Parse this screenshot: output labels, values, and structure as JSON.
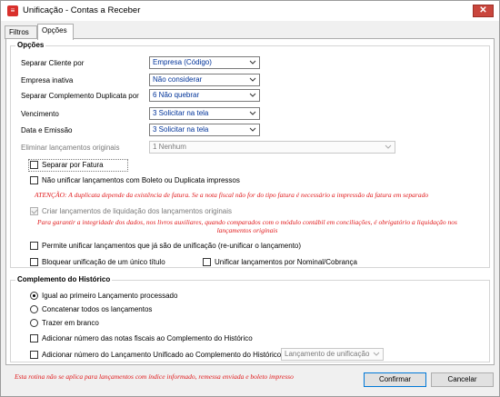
{
  "window": {
    "title": "Unificação - Contas a Receber",
    "close_label": "✕",
    "app_icon": "report-icon"
  },
  "tabs": [
    {
      "label": "Filtros",
      "active": false
    },
    {
      "label": "Opções",
      "active": true
    }
  ],
  "opcoes": {
    "legend": "Opções",
    "fields": [
      {
        "label": "Separar Cliente por",
        "value": "Empresa (Código)"
      },
      {
        "label": "Empresa inativa",
        "value": "Não considerar"
      },
      {
        "label": "Separar Complemento Duplicata por",
        "value": "6 Não quebrar"
      },
      {
        "label": "Vencimento",
        "value": "3 Solicitar na tela"
      },
      {
        "label": "Data e Emissão",
        "value": "3 Solicitar na tela"
      },
      {
        "label": "Eliminar lançamentos originais",
        "value": "1 Nenhum"
      }
    ],
    "separar_fatura": "Separar por Fatura",
    "nao_unificar": "Não unificar lançamentos com Boleto ou Duplicata impressos",
    "atencao": "ATENÇÃO: A duplicata depende da existência de fatura. Se a nota fiscal não for do tipo fatura é necessário a impressão da fatura em separado",
    "criar_lancamentos": "Criar lançamentos de liquidação dos lançamentos originais",
    "integridade": "Para garantir a integridade dos dados, nos livros auxiliares, quando comparados com o módulo contábil em conciliações, é obrigatório a liquidação nos lançamentos originais",
    "permite_unificar": "Permite unificar lançamentos que já são de unificação (re-unificar o lançamento)",
    "bloquear": "Bloquear unificação de um único título",
    "unificar_nominal": "Unificar lançamentos por Nominal/Cobrança"
  },
  "complemento": {
    "legend": "Complemento do Histórico",
    "radios": [
      {
        "label": "Igual ao primeiro Lançamento processado",
        "selected": true
      },
      {
        "label": "Concatenar todos os lançamentos",
        "selected": false
      },
      {
        "label": "Trazer em branco",
        "selected": false
      }
    ],
    "adicionar_notas": "Adicionar número das notas fiscais ao Complemento do Histórico",
    "adicionar_numero": "Adicionar número do Lançamento Unificado ao Complemento do Histórico do",
    "lancamento_select": "Lançamento de unificação"
  },
  "footer": {
    "note": "Esta rotina não se aplica para lançamentos com índice informado, remessa enviada e boleto impresso",
    "confirm": "Confirmar",
    "cancel": "Cancelar"
  }
}
